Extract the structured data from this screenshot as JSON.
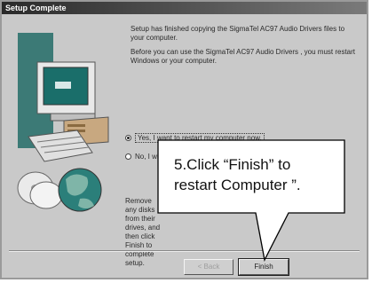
{
  "window": {
    "title": "Setup Complete"
  },
  "messages": {
    "line1": "Setup has finished copying the SigmaTel AC97 Audio Drivers files to your computer.",
    "line2": "Before you can use the SigmaTel AC97 Audio Drivers , you must restart Windows or your computer."
  },
  "options": [
    {
      "label": "Yes, I want to restart my computer now.",
      "selected": true
    },
    {
      "label": "No, I will restart my computer later.",
      "selected": false
    }
  ],
  "remove_text": "Remove any disks from their drives, and then click Finish to complete setup.",
  "buttons": {
    "back_label": "< Back",
    "finish_label": "Finish"
  },
  "callout": {
    "line1": "5.Click “Finish” to",
    "line2": "restart Computer ”."
  }
}
